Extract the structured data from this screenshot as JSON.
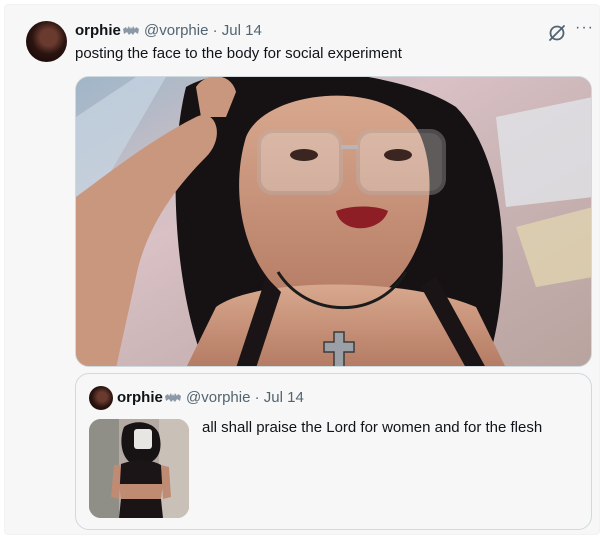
{
  "post": {
    "name": "orphie",
    "handle": "@vorphie",
    "separator": "·",
    "date": "Jul 14",
    "text": "posting the face to the body for social experiment",
    "more_label": "···",
    "media_alt": "Selfie: woman with curly black hair, clear glasses, red lips, cross pendant necklace"
  },
  "quoted": {
    "name": "orphie",
    "handle": "@vorphie",
    "separator": "·",
    "date": "Jul 14",
    "text": "all shall praise the Lord for women and for the flesh",
    "media_alt": "Mirror selfie thumbnail"
  },
  "icons": {
    "badge": "bat-icon",
    "grok": "grok-icon",
    "more": "more-icon"
  },
  "colors": {
    "text": "#0f1419",
    "muted": "#536471",
    "border": "#cfd9de",
    "background": "#f7f7f7"
  }
}
